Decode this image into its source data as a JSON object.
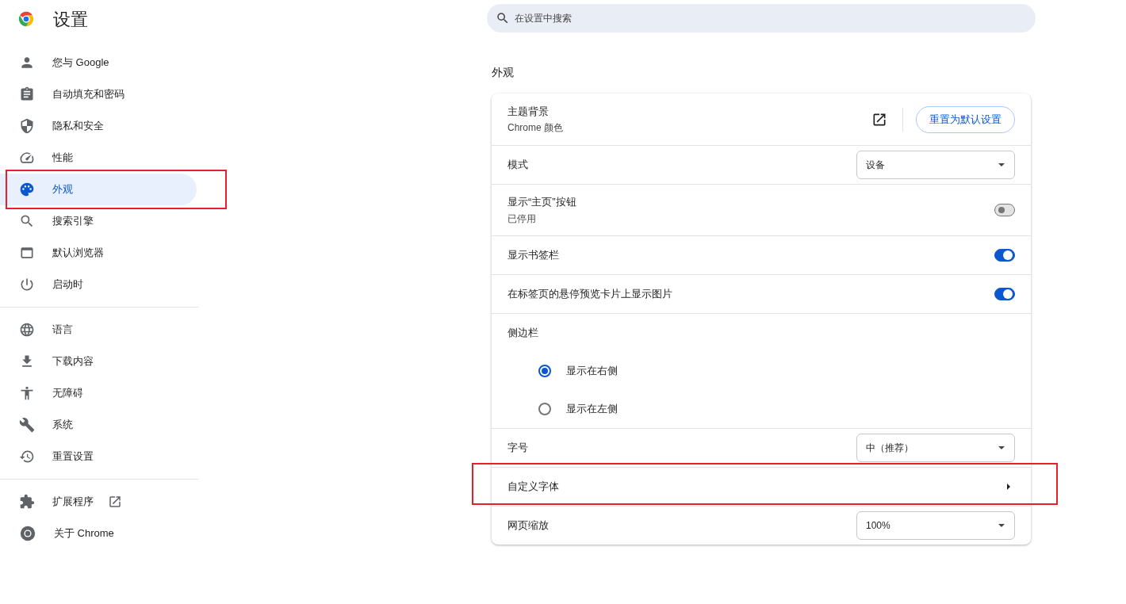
{
  "header": {
    "title": "设置"
  },
  "search": {
    "placeholder": "在设置中搜索"
  },
  "sidebar": {
    "groups": [
      [
        {
          "label": "您与 Google",
          "selected": false,
          "external": false
        },
        {
          "label": "自动填充和密码",
          "selected": false,
          "external": false
        },
        {
          "label": "隐私和安全",
          "selected": false,
          "external": false
        },
        {
          "label": "性能",
          "selected": false,
          "external": false
        },
        {
          "label": "外观",
          "selected": true,
          "external": false
        },
        {
          "label": "搜索引擎",
          "selected": false,
          "external": false
        },
        {
          "label": "默认浏览器",
          "selected": false,
          "external": false
        },
        {
          "label": "启动时",
          "selected": false,
          "external": false
        }
      ],
      [
        {
          "label": "语言",
          "selected": false,
          "external": false
        },
        {
          "label": "下载内容",
          "selected": false,
          "external": false
        },
        {
          "label": "无障碍",
          "selected": false,
          "external": false
        },
        {
          "label": "系统",
          "selected": false,
          "external": false
        },
        {
          "label": "重置设置",
          "selected": false,
          "external": false
        }
      ],
      [
        {
          "label": "扩展程序",
          "selected": false,
          "external": true
        },
        {
          "label": "关于 Chrome",
          "selected": false,
          "external": false
        }
      ]
    ]
  },
  "section": {
    "title": "外观",
    "rows": [
      {
        "kind": "theme",
        "label": "主题背景",
        "sublabel": "Chrome 颜色",
        "button": "重置为默认设置"
      },
      {
        "kind": "select",
        "label": "模式",
        "value": "设备"
      },
      {
        "kind": "toggle",
        "label": "显示“主页”按钮",
        "sublabel": "已停用",
        "on": false
      },
      {
        "kind": "toggle",
        "label": "显示书签栏",
        "on": true
      },
      {
        "kind": "toggle",
        "label": "在标签页的悬停预览卡片上显示图片",
        "on": true
      },
      {
        "kind": "radio_group",
        "label": "侧边栏",
        "options": [
          {
            "label": "显示在右侧",
            "selected": true
          },
          {
            "label": "显示在左侧",
            "selected": false
          }
        ]
      },
      {
        "kind": "select",
        "label": "字号",
        "value": "中（推荐）"
      },
      {
        "kind": "link",
        "label": "自定义字体"
      },
      {
        "kind": "select",
        "label": "网页缩放",
        "value": "100%"
      }
    ]
  }
}
